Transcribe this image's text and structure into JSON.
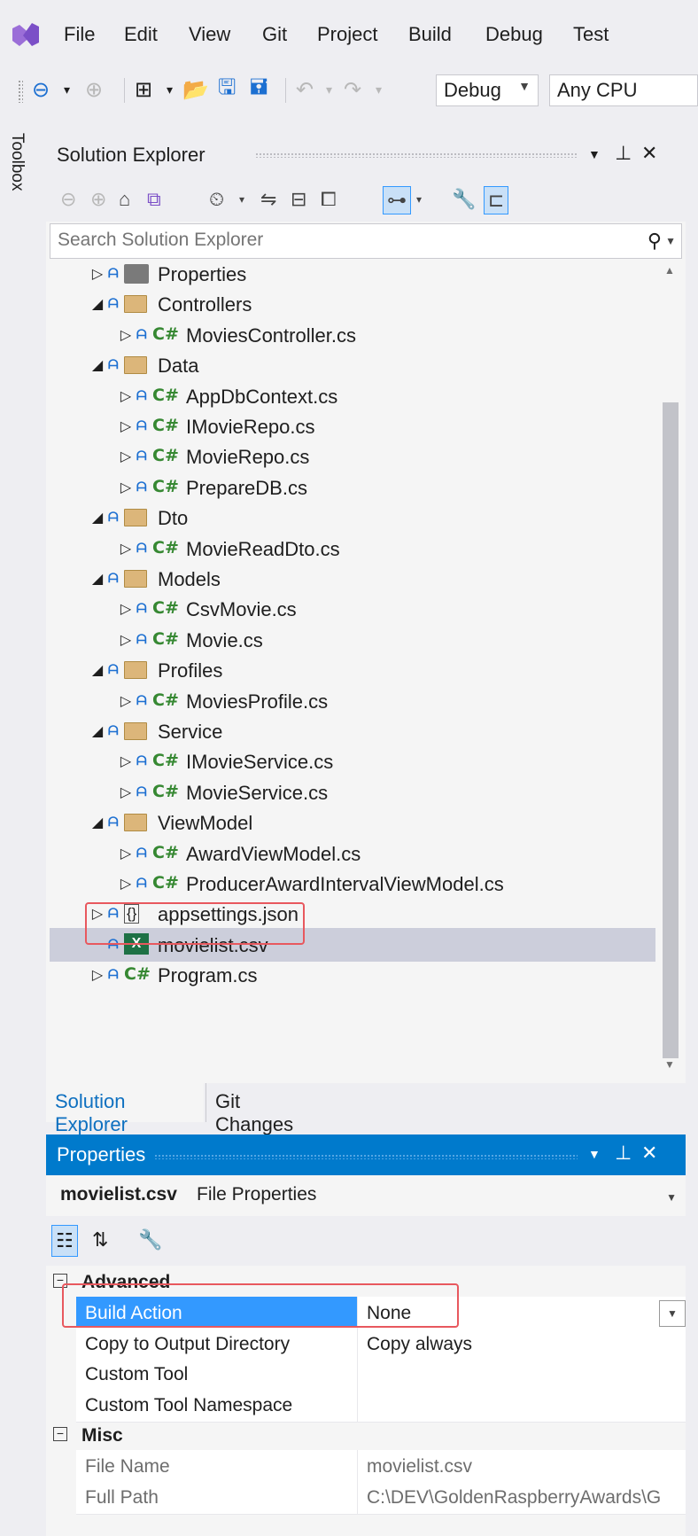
{
  "menu": {
    "items": [
      "File",
      "Edit",
      "View",
      "Git",
      "Project",
      "Build",
      "Debug",
      "Test"
    ]
  },
  "toolbar": {
    "config_combo": "Debug",
    "platform_combo": "Any CPU"
  },
  "toolbox_tab": "Toolbox",
  "solution_explorer": {
    "title": "Solution Explorer",
    "search_placeholder": "Search Solution Explorer",
    "tree": [
      {
        "label": "Properties",
        "type": "properties",
        "expanded": false,
        "level": 0
      },
      {
        "label": "Controllers",
        "type": "folder",
        "expanded": true,
        "level": 0
      },
      {
        "label": "MoviesController.cs",
        "type": "cs",
        "expanded": false,
        "level": 1
      },
      {
        "label": "Data",
        "type": "folder",
        "expanded": true,
        "level": 0
      },
      {
        "label": "AppDbContext.cs",
        "type": "cs",
        "expanded": false,
        "level": 1
      },
      {
        "label": "IMovieRepo.cs",
        "type": "cs",
        "expanded": false,
        "level": 1
      },
      {
        "label": "MovieRepo.cs",
        "type": "cs",
        "expanded": false,
        "level": 1
      },
      {
        "label": "PrepareDB.cs",
        "type": "cs",
        "expanded": false,
        "level": 1
      },
      {
        "label": "Dto",
        "type": "folder",
        "expanded": true,
        "level": 0
      },
      {
        "label": "MovieReadDto.cs",
        "type": "cs",
        "expanded": false,
        "level": 1
      },
      {
        "label": "Models",
        "type": "folder",
        "expanded": true,
        "level": 0
      },
      {
        "label": "CsvMovie.cs",
        "type": "cs",
        "expanded": false,
        "level": 1
      },
      {
        "label": "Movie.cs",
        "type": "cs",
        "expanded": false,
        "level": 1
      },
      {
        "label": "Profiles",
        "type": "folder",
        "expanded": true,
        "level": 0
      },
      {
        "label": "MoviesProfile.cs",
        "type": "cs",
        "expanded": false,
        "level": 1
      },
      {
        "label": "Service",
        "type": "folder",
        "expanded": true,
        "level": 0
      },
      {
        "label": "IMovieService.cs",
        "type": "cs",
        "expanded": false,
        "level": 1
      },
      {
        "label": "MovieService.cs",
        "type": "cs",
        "expanded": false,
        "level": 1
      },
      {
        "label": "ViewModel",
        "type": "folder",
        "expanded": true,
        "level": 0
      },
      {
        "label": "AwardViewModel.cs",
        "type": "cs",
        "expanded": false,
        "level": 1
      },
      {
        "label": "ProducerAwardIntervalViewModel.cs",
        "type": "cs",
        "expanded": false,
        "level": 1
      },
      {
        "label": "appsettings.json",
        "type": "json",
        "expanded": false,
        "level": 0
      },
      {
        "label": "movielist.csv",
        "type": "excel",
        "expanded": null,
        "level": 0,
        "selected": true
      },
      {
        "label": "Program.cs",
        "type": "cs",
        "expanded": false,
        "level": 0
      }
    ],
    "tabs": [
      "Solution Explorer",
      "Git Changes"
    ]
  },
  "properties": {
    "title": "Properties",
    "object_name": "movielist.csv",
    "object_type": "File Properties",
    "categories": [
      {
        "name": "Advanced",
        "rows": [
          {
            "name": "Build Action",
            "value": "None",
            "selected": true
          },
          {
            "name": "Copy to Output Directory",
            "value": "Copy always"
          },
          {
            "name": "Custom Tool",
            "value": ""
          },
          {
            "name": "Custom Tool Namespace",
            "value": ""
          }
        ]
      },
      {
        "name": "Misc",
        "rows": [
          {
            "name": "File Name",
            "value": "movielist.csv",
            "readonly": true
          },
          {
            "name": "Full Path",
            "value": "C:\\DEV\\GoldenRaspberryAwards\\G",
            "readonly": true
          }
        ]
      }
    ]
  },
  "icons": {
    "expander_collapsed": "▷",
    "expander_expanded": "◢",
    "lock": "🔒"
  },
  "colors": {
    "accent": "#007acc",
    "selection": "#3399ff",
    "highlight_box": "#e8585e",
    "csharp_icon": "#368832",
    "folder": "#dcb67a"
  }
}
